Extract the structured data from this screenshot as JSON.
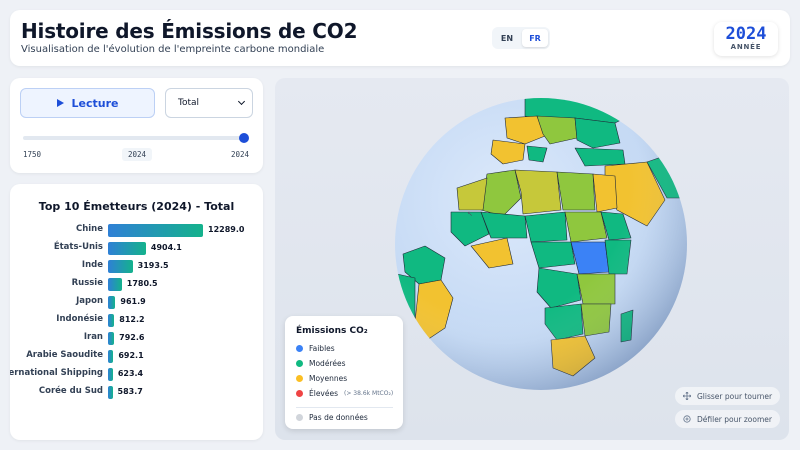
{
  "header": {
    "title": "Histoire des Émissions de CO2",
    "subtitle": "Visualisation de l'évolution de l'empreinte carbone mondiale",
    "lang_en": "EN",
    "lang_fr": "FR",
    "active_lang": "FR",
    "year_value": "2024",
    "year_label": "ANNÉE"
  },
  "controls": {
    "play_label": "Lecture",
    "selected_metric": "Total",
    "slider_min": "1750",
    "slider_current": "2024",
    "slider_max": "2024",
    "slider_fraction": 1.0
  },
  "top10": {
    "title": "Top 10 Émetteurs (2024) - Total",
    "max_value": 12289.0,
    "items": [
      {
        "name": "Chine",
        "value": "12289.0",
        "num": 12289.0
      },
      {
        "name": "États-Unis",
        "value": "4904.1",
        "num": 4904.1
      },
      {
        "name": "Inde",
        "value": "3193.5",
        "num": 3193.5
      },
      {
        "name": "Russie",
        "value": "1780.5",
        "num": 1780.5
      },
      {
        "name": "Japon",
        "value": "961.9",
        "num": 961.9
      },
      {
        "name": "Indonésie",
        "value": "812.2",
        "num": 812.2
      },
      {
        "name": "Iran",
        "value": "792.6",
        "num": 792.6
      },
      {
        "name": "Arabie Saoudite",
        "value": "692.1",
        "num": 692.1
      },
      {
        "name": "International Shipping",
        "value": "623.4",
        "num": 623.4
      },
      {
        "name": "Corée du Sud",
        "value": "583.7",
        "num": 583.7
      }
    ]
  },
  "legend": {
    "title": "Émissions CO₂",
    "items": [
      {
        "label": "Faibles",
        "color": "#3b82f6",
        "note": ""
      },
      {
        "label": "Modérées",
        "color": "#10b981",
        "note": ""
      },
      {
        "label": "Moyennes",
        "color": "#fbbf24",
        "note": ""
      },
      {
        "label": "Élevées",
        "color": "#ef4444",
        "note": "(> 38.6k MtCO₂)"
      },
      {
        "label": "Pas de données",
        "color": "#d1d5db",
        "note": ""
      }
    ]
  },
  "hints": {
    "drag": "Glisser pour tourner",
    "scroll": "Défiler pour zoomer"
  },
  "colors": {
    "ocean": "#c8dcf4",
    "accent": "#1d4ed8"
  }
}
